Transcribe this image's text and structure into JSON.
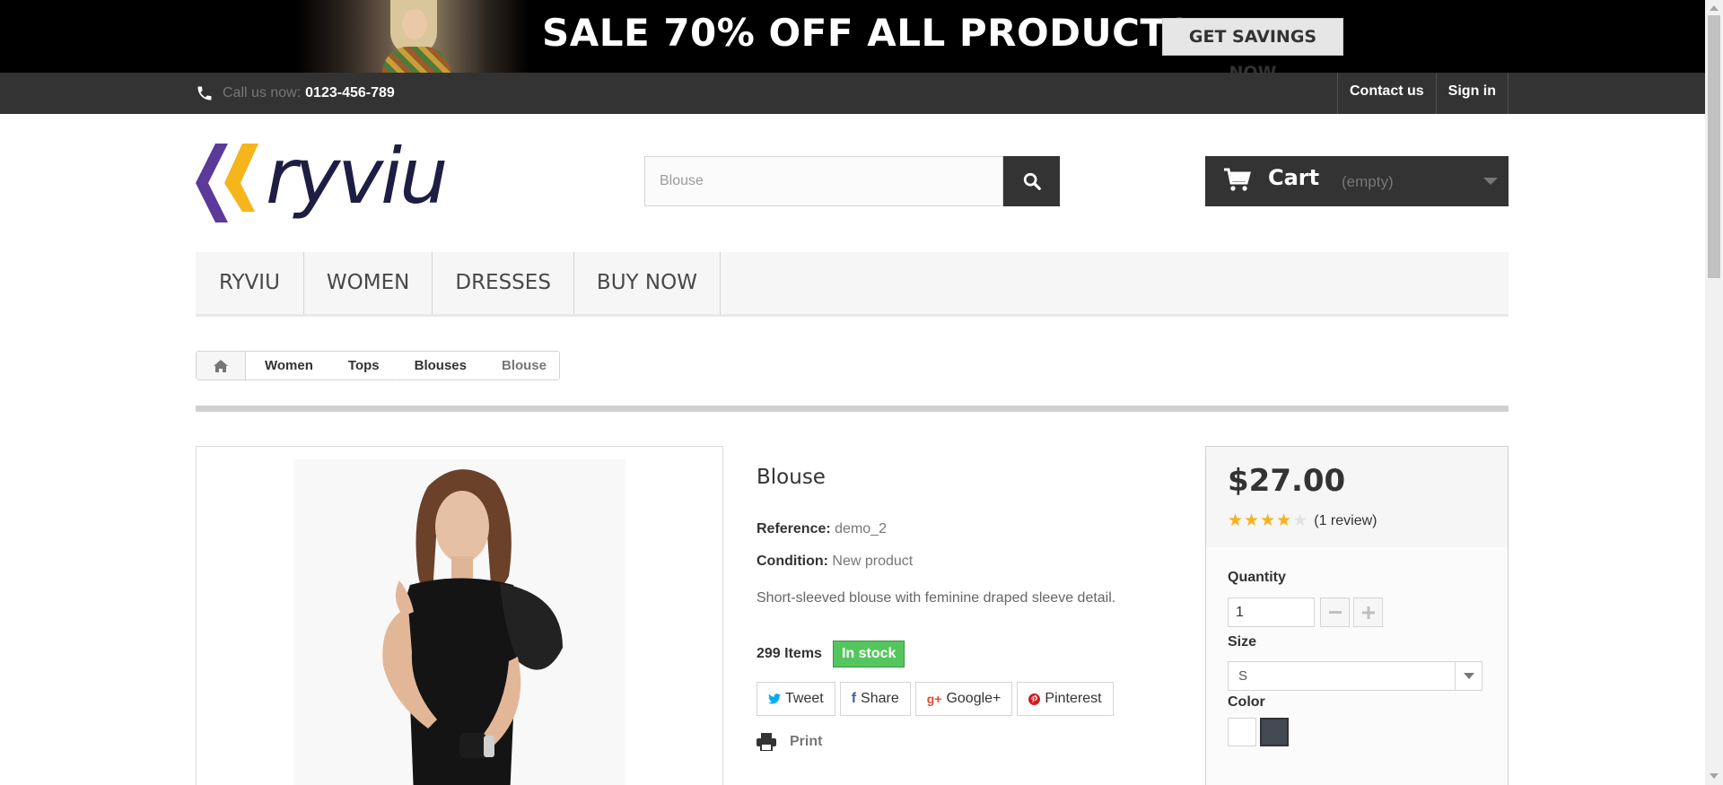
{
  "banner": {
    "headline": "SALE 70% OFF ALL PRODUCTS",
    "cta": "GET SAVINGS NOW"
  },
  "topbar": {
    "call_label": "Call us now:",
    "phone": "0123-456-789",
    "links": [
      "Contact us",
      "Sign in"
    ]
  },
  "header": {
    "logo_text": "ryviu",
    "search": {
      "value": "Blouse"
    },
    "cart": {
      "label": "Cart",
      "status": "(empty)"
    }
  },
  "menu": [
    "RYVIU",
    "WOMEN",
    "DRESSES",
    "BUY NOW"
  ],
  "breadcrumb": [
    "Women",
    "Tops",
    "Blouses",
    "Blouse"
  ],
  "product": {
    "title": "Blouse",
    "reference_label": "Reference:",
    "reference": "demo_2",
    "condition_label": "Condition:",
    "condition": "New product",
    "description": "Short-sleeved blouse with feminine draped sleeve detail.",
    "items": "299 Items",
    "stock": "In stock",
    "share": [
      "Tweet",
      "Share",
      "Google+",
      "Pinterest"
    ],
    "print": "Print"
  },
  "buy": {
    "price": "$27.00",
    "rating": 4,
    "rating_max": 5,
    "reviews": "(1 review)",
    "quantity_label": "Quantity",
    "quantity": "1",
    "size_label": "Size",
    "size": "S",
    "color_label": "Color",
    "colors": [
      "#ffffff",
      "#434a54"
    ]
  },
  "colors": {
    "dark": "#333333",
    "stock_green": "#55c65e",
    "star": "#f5b21b",
    "logo_purple": "#5b3a9a",
    "logo_yellow": "#f5b51b"
  }
}
